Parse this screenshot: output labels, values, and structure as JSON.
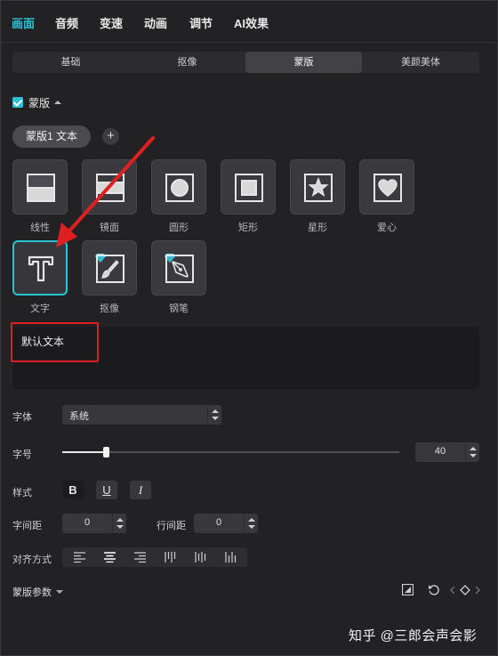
{
  "top_tabs": [
    {
      "label": "画面",
      "active": true
    },
    {
      "label": "音频"
    },
    {
      "label": "变速"
    },
    {
      "label": "动画"
    },
    {
      "label": "调节"
    },
    {
      "label": "AI效果"
    }
  ],
  "sub_tabs": [
    {
      "label": "基础"
    },
    {
      "label": "抠像"
    },
    {
      "label": "蒙版",
      "active": true
    },
    {
      "label": "美颜美体"
    }
  ],
  "mask_section": {
    "label": "蒙版",
    "checked": true
  },
  "mask_chip": {
    "label": "蒙版1 文本"
  },
  "add_button": {
    "label": "+"
  },
  "shapes": [
    {
      "label": "线性",
      "icon": "linear-mask-icon"
    },
    {
      "label": "镜面",
      "icon": "mirror-mask-icon"
    },
    {
      "label": "圆形",
      "icon": "circle-mask-icon"
    },
    {
      "label": "矩形",
      "icon": "rectangle-mask-icon"
    },
    {
      "label": "星形",
      "icon": "star-mask-icon"
    },
    {
      "label": "爱心",
      "icon": "heart-mask-icon"
    },
    {
      "label": "文字",
      "icon": "text-mask-icon",
      "selected": true
    },
    {
      "label": "抠像",
      "icon": "brush-mask-icon",
      "premium": true
    },
    {
      "label": "钢笔",
      "icon": "pen-mask-icon",
      "premium": true
    }
  ],
  "text_input": {
    "value": "默认文本"
  },
  "font": {
    "label": "字体",
    "value": "系统"
  },
  "size": {
    "label": "字号",
    "value": "40",
    "slider_fraction": 0.13
  },
  "style": {
    "label": "样式",
    "bold": "B",
    "underline": "U",
    "italic": "I"
  },
  "spacing": {
    "char_label": "字间距",
    "char_value": "0",
    "line_label": "行间距",
    "line_value": "0"
  },
  "alignment": {
    "label": "对齐方式",
    "options": [
      "align-left-icon",
      "align-center-icon",
      "align-right-icon",
      "vertical-top-icon",
      "vertical-center-icon",
      "vertical-bottom-icon"
    ],
    "selected": 1
  },
  "mask_params": {
    "label": "蒙版参数"
  },
  "watermark": {
    "text": "知乎 @三郎会声会影"
  },
  "colors": {
    "accent": "#29c3d4",
    "annotation": "#e02020"
  }
}
